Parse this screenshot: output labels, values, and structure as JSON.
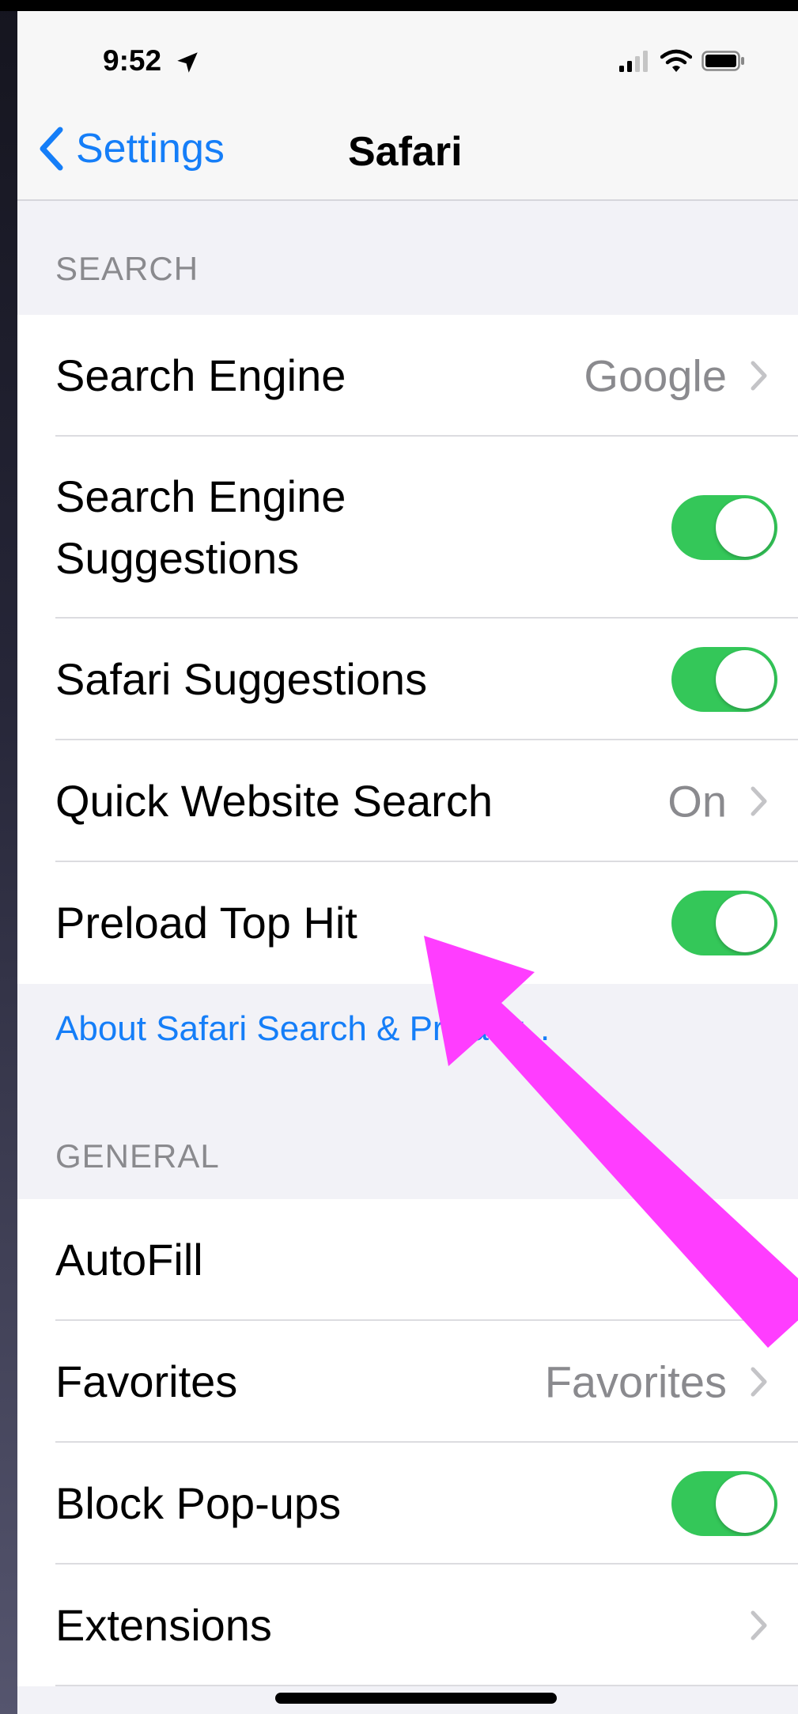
{
  "status_bar": {
    "time": "9:52",
    "location_icon": "location-arrow-icon",
    "signal_icon": "cellular-signal-icon",
    "wifi_icon": "wifi-icon",
    "battery_icon": "battery-icon"
  },
  "nav": {
    "back_label": "Settings",
    "title": "Safari"
  },
  "sections": {
    "search": {
      "header": "SEARCH",
      "rows": [
        {
          "label": "Search Engine",
          "value": "Google",
          "control": "disclosure"
        },
        {
          "label": "Search Engine Suggestions",
          "control": "toggle",
          "on": true
        },
        {
          "label": "Safari Suggestions",
          "control": "toggle",
          "on": true
        },
        {
          "label": "Quick Website Search",
          "value": "On",
          "control": "disclosure"
        },
        {
          "label": "Preload Top Hit",
          "control": "toggle",
          "on": true
        }
      ],
      "footer_link": "About Safari Search & Privacy..."
    },
    "general": {
      "header": "GENERAL",
      "rows": [
        {
          "label": "AutoFill",
          "control": "disclosure"
        },
        {
          "label": "Favorites",
          "value": "Favorites",
          "control": "disclosure"
        },
        {
          "label": "Block Pop-ups",
          "control": "toggle",
          "on": true
        },
        {
          "label": "Extensions",
          "control": "disclosure"
        }
      ]
    }
  },
  "colors": {
    "accent": "#157ef8",
    "toggle_on": "#34c759",
    "annotation_arrow": "#ff3dff",
    "secondary_text": "#8a8a8e"
  },
  "annotation": {
    "type": "arrow",
    "points_to": "Preload Top Hit"
  }
}
